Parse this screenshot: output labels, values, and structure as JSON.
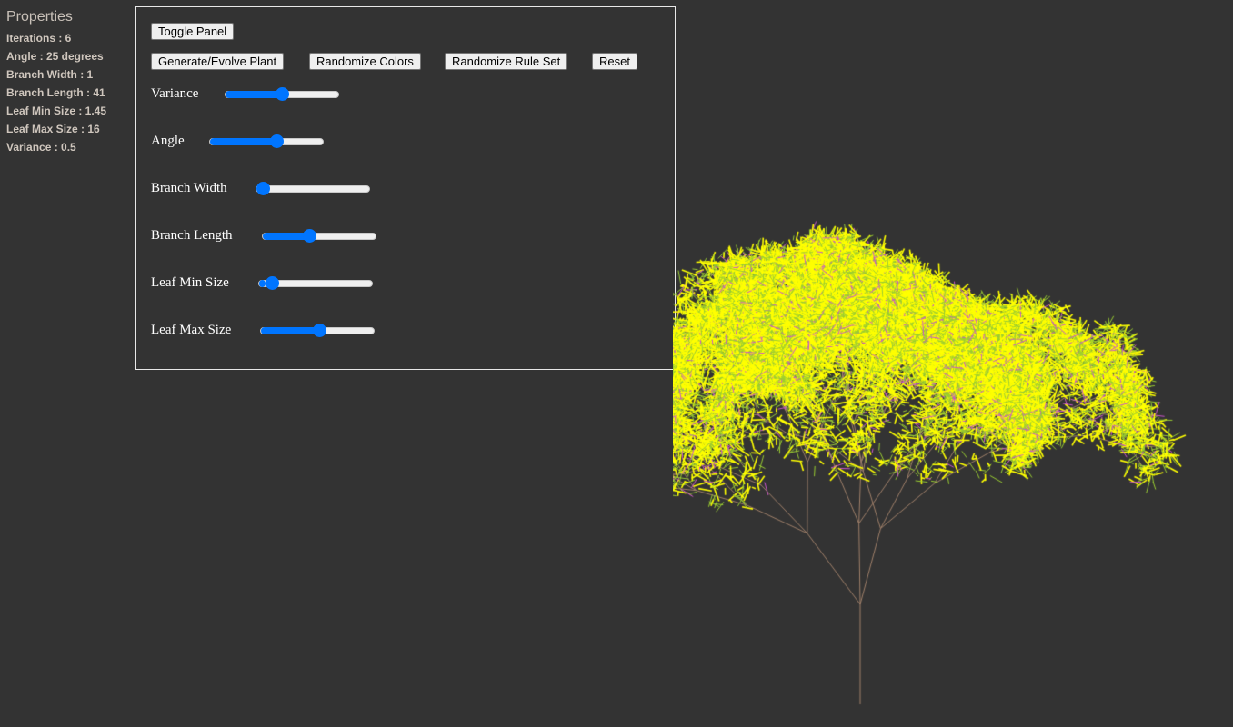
{
  "properties": {
    "title": "Properties",
    "rows": [
      "Iterations : 6",
      "Angle : 25 degrees",
      "Branch Width : 1",
      "Branch Length : 41",
      "Leaf Min Size : 1.45",
      "Leaf Max Size : 16",
      "Variance : 0.5"
    ]
  },
  "panel": {
    "toggle_label": "Toggle Panel",
    "generate_label": "Generate/Evolve Plant",
    "randomize_colors_label": "Randomize Colors",
    "randomize_rules_label": "Randomize Rule Set",
    "reset_label": "Reset",
    "sliders": [
      {
        "label": "Variance",
        "percent": 50
      },
      {
        "label": "Angle",
        "percent": 60
      },
      {
        "label": "Branch Width",
        "percent": 0
      },
      {
        "label": "Branch Length",
        "percent": 40
      },
      {
        "label": "Leaf Min Size",
        "percent": 6
      },
      {
        "label": "Leaf Max Size",
        "percent": 52
      }
    ]
  },
  "colors": {
    "branch": "#a0806a",
    "leaf1": "#ffff00",
    "leaf2": "#9acd32",
    "leaf3": "#cc55cc"
  }
}
